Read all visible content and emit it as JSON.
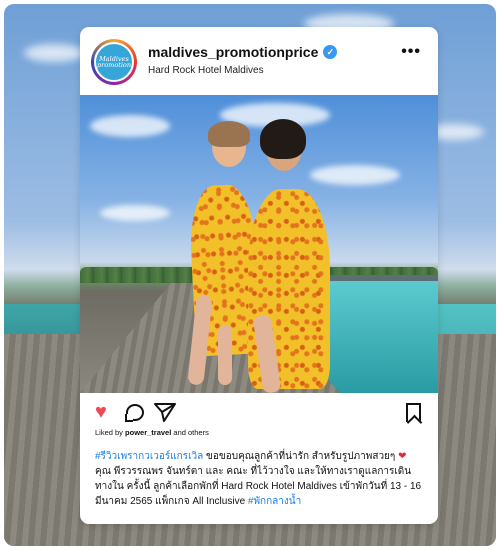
{
  "post": {
    "username": "maldives_promotionprice",
    "location": "Hard Rock Hotel Maldives",
    "avatar_line1": "Maldives",
    "avatar_line2": "promotion",
    "more_icon": "more-horizontal-icon",
    "verified_icon": "verified-badge-icon",
    "likes_prefix": "Liked by ",
    "likes_user": "power_travel",
    "likes_suffix": " and others",
    "caption": {
      "hashtag1": "#รีวิวเพรากวเวอร์แกรเวิล",
      "text1": " ขอขอบคุณลูกค้าที่น่ารัก สำหรับรูปภาพสวยๆ ",
      "heart": "❤",
      "text2": "คุณ พีรวรรณพร จันทร์ตา และ คณะ ที่ไว้วางใจ และให้ทางเราดูแลการเดินทางใน ครั้งนี้ ลูกค้าเลือกพักที่ Hard Rock Hotel Maldives  เข้าพักวันที่ 13 - 16 มีนาคม 2565 แพ็กเกจ All Inclusive ",
      "hashtag2": "#พักกลางน้ำ"
    },
    "icons": {
      "like": "heart-icon",
      "comment": "comment-icon",
      "share": "share-icon",
      "save": "bookmark-icon"
    },
    "colors": {
      "like": "#ed4956",
      "hashtag": "#1d7fe0",
      "verified": "#3897f0",
      "avatar_bg": "#36a6d8"
    }
  }
}
